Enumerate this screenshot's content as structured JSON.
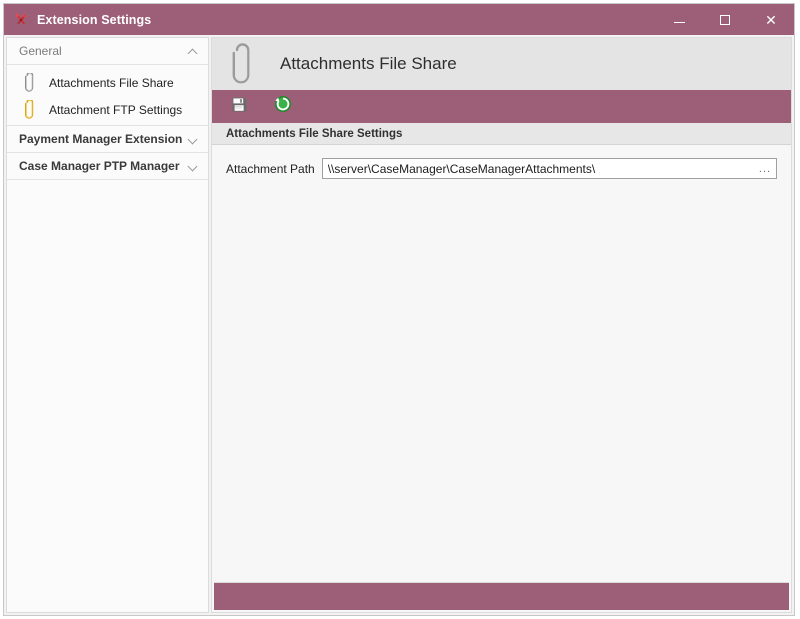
{
  "window": {
    "title": "Extension Settings",
    "icon": "tools-icon",
    "controls": {
      "minimize": "–",
      "maximize": "□",
      "close": "✕"
    }
  },
  "sidebar": {
    "groups": [
      {
        "label": "General",
        "state": "expanded",
        "chevron": "chevron-up-icon",
        "items": [
          {
            "label": "Attachments File Share",
            "icon": "paperclip-icon-silver"
          },
          {
            "label": "Attachment FTP Settings",
            "icon": "paperclip-icon-gold"
          }
        ]
      },
      {
        "label": "Payment Manager Extension",
        "state": "collapsed",
        "chevron": "chevron-down-icon",
        "items": []
      },
      {
        "label": "Case Manager PTP Manager",
        "state": "collapsed",
        "chevron": "chevron-down-icon",
        "items": []
      }
    ]
  },
  "page": {
    "header_icon": "paperclip-icon-large",
    "title": "Attachments File Share",
    "toolbar": [
      {
        "name": "save-button",
        "icon": "save-floppy-icon"
      },
      {
        "name": "refresh-button",
        "icon": "refresh-green-icon"
      }
    ],
    "section": {
      "title": "Attachments File Share Settings",
      "fields": [
        {
          "label": "Attachment Path",
          "value": "\\\\server\\CaseManager\\CaseManagerAttachments\\",
          "placeholder": "",
          "browse_label": "..."
        }
      ]
    },
    "statusbar_text": ""
  },
  "colors": {
    "accent": "#9c5f77",
    "header_bg": "#e4e4e4",
    "section_bg": "#e7e7e7",
    "content_bg": "#f7f7f7",
    "sidebar_bg": "#fbfbfb"
  }
}
